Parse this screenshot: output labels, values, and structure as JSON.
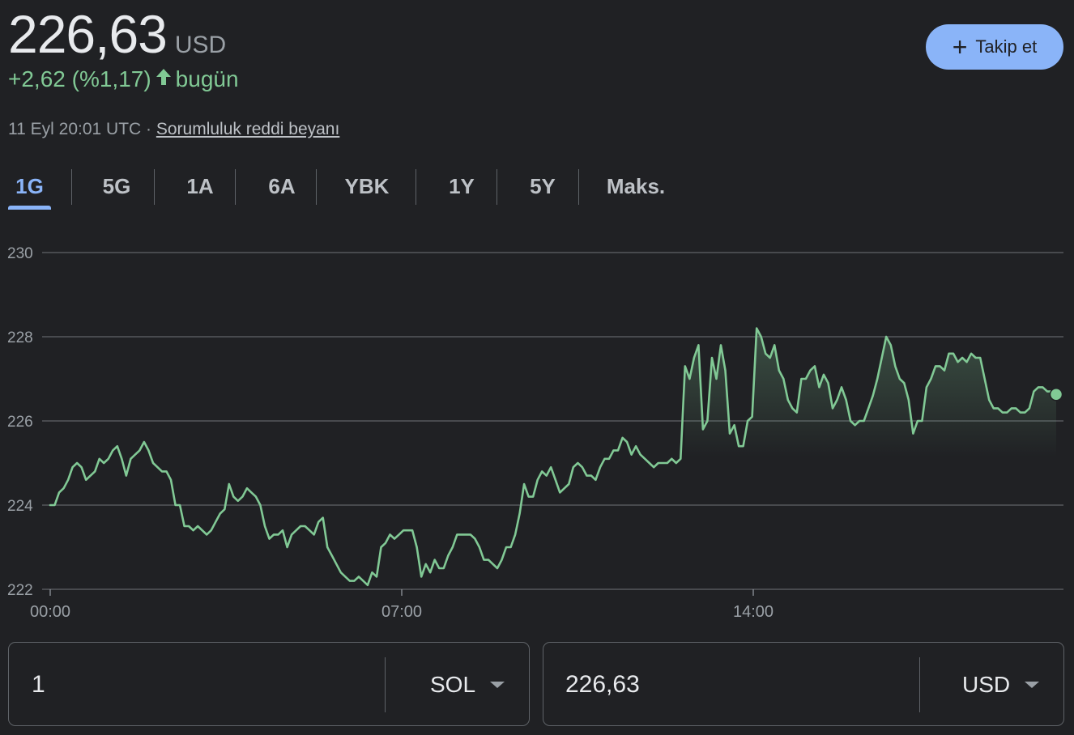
{
  "quote": {
    "price": "226,63",
    "currency": "USD",
    "change": "+2,62 (%1,17)",
    "change_suffix": "bugün",
    "change_color": "#81c995",
    "timestamp": "11 Eyl 20:01 UTC ·",
    "disclaimer": "Sorumluluk reddi beyanı"
  },
  "follow_button": {
    "label": "Takip et",
    "icon": "plus-icon",
    "color": "#8ab4f8"
  },
  "tabs": [
    {
      "label": "1G",
      "active": true
    },
    {
      "label": "5G"
    },
    {
      "label": "1A"
    },
    {
      "label": "6A"
    },
    {
      "label": "YBK"
    },
    {
      "label": "1Y"
    },
    {
      "label": "5Y"
    },
    {
      "label": "Maks."
    }
  ],
  "converter": {
    "left": {
      "value": "1",
      "unit": "SOL"
    },
    "right": {
      "value": "226,63",
      "unit": "USD"
    }
  },
  "chart_data": {
    "type": "line",
    "xlabel": "",
    "ylabel": "",
    "ylim": [
      222,
      230
    ],
    "yticks": [
      "230",
      "228",
      "226",
      "224",
      "222"
    ],
    "xticks": [
      "00:00",
      "07:00",
      "14:00"
    ],
    "grid": true,
    "line_color": "#81c995",
    "series": [
      {
        "x_start": "00:00",
        "x_end": "20:01",
        "values": [
          224.0,
          224.0,
          224.3,
          224.4,
          224.6,
          224.9,
          225.0,
          224.9,
          224.6,
          224.7,
          224.8,
          225.1,
          225.0,
          225.1,
          225.3,
          225.4,
          225.1,
          224.7,
          225.1,
          225.2,
          225.3,
          225.5,
          225.3,
          225.0,
          224.9,
          224.8,
          224.8,
          224.6,
          224.0,
          224.0,
          223.5,
          223.5,
          223.4,
          223.5,
          223.4,
          223.3,
          223.4,
          223.6,
          223.8,
          223.9,
          224.5,
          224.2,
          224.1,
          224.2,
          224.4,
          224.3,
          224.2,
          224.0,
          223.5,
          223.2,
          223.3,
          223.3,
          223.4,
          223.0,
          223.3,
          223.4,
          223.5,
          223.5,
          223.4,
          223.3,
          223.6,
          223.7,
          223.0,
          222.8,
          222.6,
          222.4,
          222.3,
          222.2,
          222.2,
          222.3,
          222.2,
          222.1,
          222.4,
          222.3,
          223.0,
          223.1,
          223.3,
          223.2,
          223.3,
          223.4,
          223.4,
          223.4,
          223.0,
          222.3,
          222.6,
          222.4,
          222.7,
          222.5,
          222.5,
          222.8,
          223.0,
          223.3,
          223.3,
          223.3,
          223.3,
          223.2,
          223.0,
          222.7,
          222.7,
          222.6,
          222.5,
          222.7,
          223.0,
          223.0,
          223.3,
          223.8,
          224.5,
          224.2,
          224.2,
          224.6,
          224.8,
          224.7,
          224.9,
          224.6,
          224.3,
          224.4,
          224.5,
          224.9,
          225.0,
          224.9,
          224.7,
          224.7,
          224.6,
          224.9,
          225.1,
          225.1,
          225.3,
          225.3,
          225.6,
          225.5,
          225.2,
          225.4,
          225.2,
          225.1,
          225.0,
          224.9,
          225.0,
          225.0,
          225.0,
          225.1,
          225.0,
          225.1,
          227.3,
          227.0,
          227.5,
          227.8,
          225.8,
          226.0,
          227.5,
          227.0,
          227.8,
          227.2,
          225.7,
          225.9,
          225.4,
          225.4,
          226.0,
          226.1,
          228.2,
          228.0,
          227.6,
          227.5,
          227.8,
          227.2,
          227.0,
          226.5,
          226.3,
          226.2,
          227.0,
          227.0,
          227.2,
          227.3,
          226.8,
          227.1,
          226.9,
          226.3,
          226.5,
          226.8,
          226.5,
          226.0,
          225.9,
          226.0,
          226.0,
          226.3,
          226.6,
          227.0,
          227.5,
          228.0,
          227.8,
          227.3,
          227.0,
          226.9,
          226.5,
          225.7,
          226.0,
          226.0,
          226.8,
          227.0,
          227.3,
          227.3,
          227.2,
          227.6,
          227.6,
          227.4,
          227.5,
          227.4,
          227.6,
          227.5,
          227.5,
          227.0,
          226.5,
          226.3,
          226.3,
          226.2,
          226.2,
          226.3,
          226.3,
          226.2,
          226.2,
          226.3,
          226.7,
          226.8,
          226.8,
          226.7,
          226.7,
          226.63
        ]
      }
    ],
    "last_value": 226.63
  }
}
